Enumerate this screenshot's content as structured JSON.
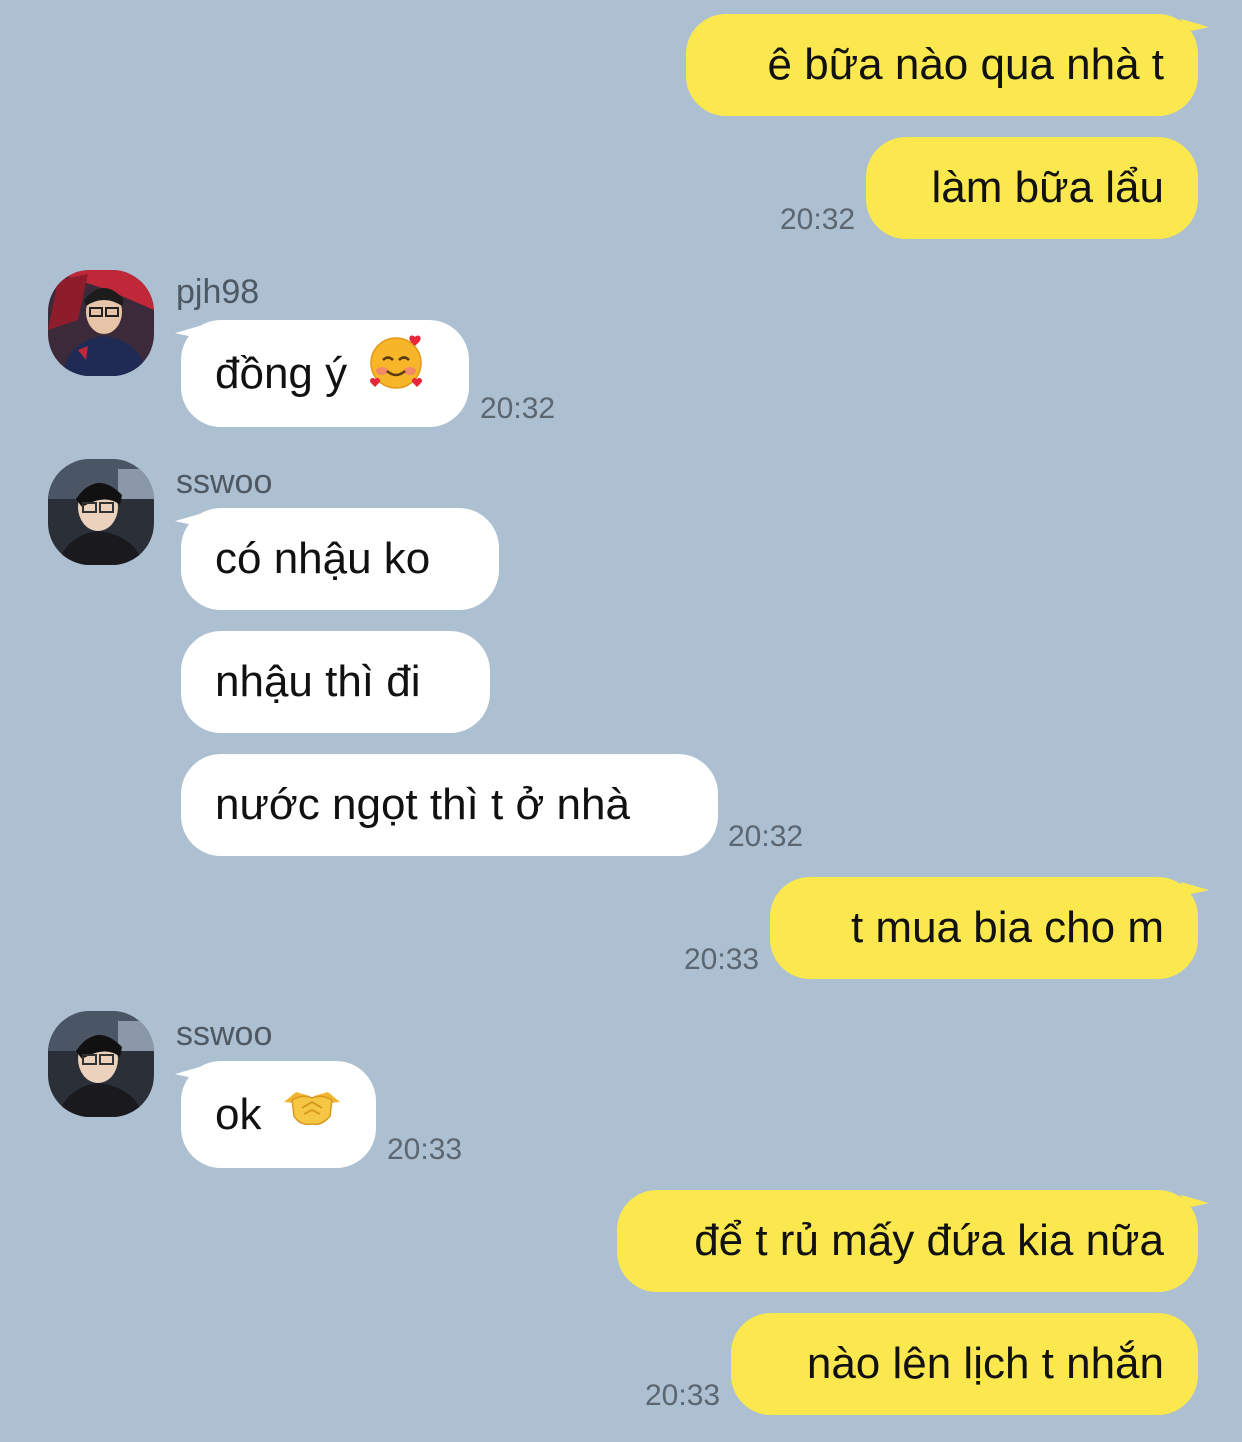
{
  "colors": {
    "background": "#adc0d1",
    "outgoing_bubble": "#fbe84e",
    "incoming_bubble": "#ffffff",
    "timestamp": "#5c6670",
    "sender_name": "#4d5863"
  },
  "messages": [
    {
      "direction": "outgoing",
      "text": "ê bữa nào qua nhà t"
    },
    {
      "direction": "outgoing",
      "text": "làm bữa lẩu",
      "time": "20:32"
    },
    {
      "direction": "incoming",
      "sender": "pjh98",
      "avatar": "profile-photo",
      "text": "đồng ý",
      "emoji": "smiling-face-with-hearts-icon",
      "time": "20:32"
    },
    {
      "direction": "incoming",
      "sender": "sswoo",
      "avatar": "profile-photo",
      "text": "có nhậu ko"
    },
    {
      "direction": "incoming",
      "text": "nhậu thì đi"
    },
    {
      "direction": "incoming",
      "text": "nước ngọt thì t ở nhà",
      "time": "20:32"
    },
    {
      "direction": "outgoing",
      "text": "t mua bia cho m",
      "time": "20:33"
    },
    {
      "direction": "incoming",
      "sender": "sswoo",
      "avatar": "profile-photo",
      "text": "ok",
      "emoji": "handshake-icon",
      "time": "20:33"
    },
    {
      "direction": "outgoing",
      "text": "để t rủ mấy đứa kia nữa"
    },
    {
      "direction": "outgoing",
      "text": "nào lên lịch t nhắn",
      "time": "20:33"
    }
  ]
}
